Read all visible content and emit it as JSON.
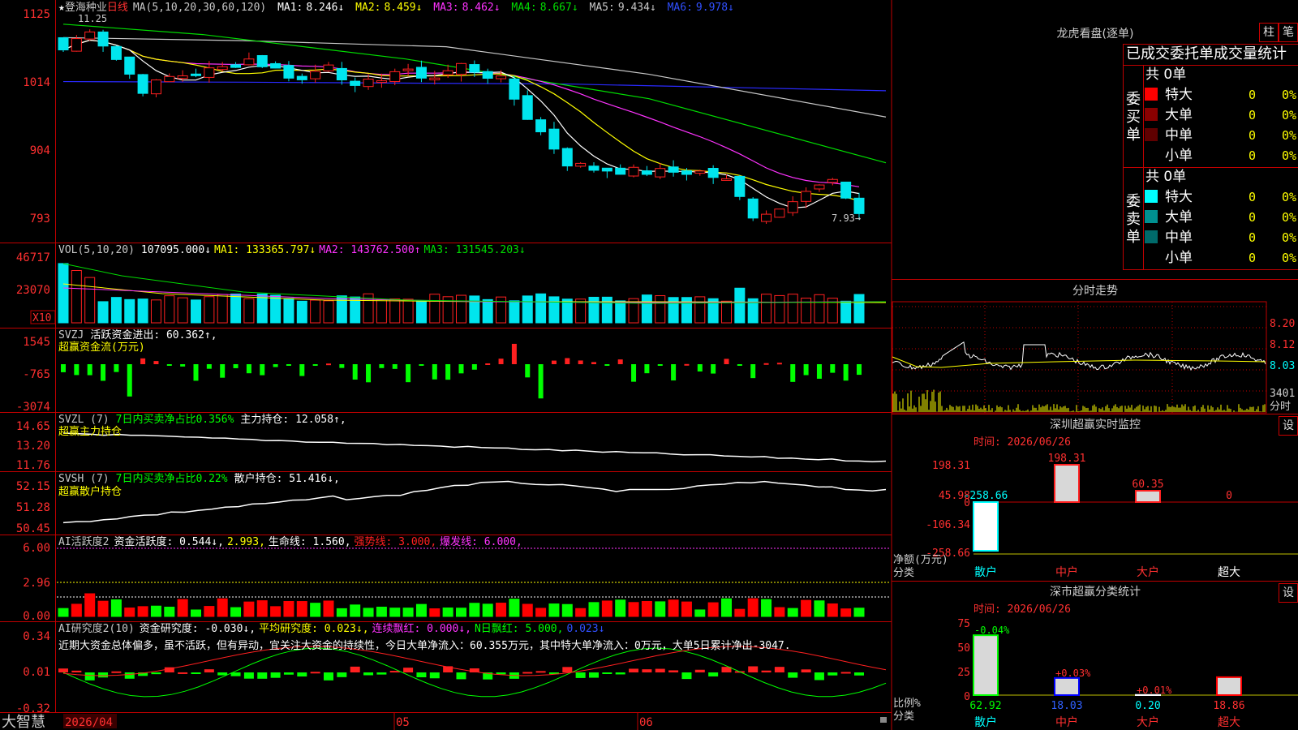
{
  "colors": {
    "up": "#ff2020",
    "down": "#00e5ee",
    "border": "#c00000",
    "axis_text": "#ff3030",
    "ma1": "#ffffff",
    "ma2": "#ffff00",
    "ma3": "#ff33ff",
    "ma4": "#00dd00",
    "ma5": "#c8c8c8",
    "ma6": "#2a2aff"
  },
  "chart": {
    "stock_name": "登海种业",
    "period": "日线",
    "ma_params": "MA(5,10,20,30,60,120)",
    "ma": [
      {
        "label": "MA1:",
        "value": "8.246↓"
      },
      {
        "label": "MA2:",
        "value": "8.459↓"
      },
      {
        "label": "MA3:",
        "value": "8.462↓"
      },
      {
        "label": "MA4:",
        "value": "8.667↓"
      },
      {
        "label": "MA5:",
        "value": "9.434↓"
      },
      {
        "label": "MA6:",
        "value": "9.978↓"
      }
    ],
    "high_note": "11.25",
    "low_note": "7.93→",
    "price_axis": [
      "1125",
      "1014",
      "904",
      "793"
    ],
    "vol": {
      "params": "VOL(5,10,20)",
      "value": "107095.000↓",
      "ma1": "MA1: 133365.797↓",
      "ma2": "MA2: 143762.500↑",
      "ma3": "MA3: 131545.203↓",
      "axis": [
        "46717",
        "23070"
      ],
      "unit": "X10"
    },
    "svzj": {
      "name": "SVZJ",
      "label": "活跃资金进出: 60.362↑,",
      "sub": "超赢资金流(万元)",
      "axis": [
        "1545",
        "-765",
        "-3074"
      ]
    },
    "svzl": {
      "name": "SVZL (7)",
      "label1": "7日内买卖净占比0.356%",
      "label2": "主力持仓: 12.058↑,",
      "sub": "超赢主力持仓",
      "axis": [
        "14.65",
        "13.20",
        "11.76"
      ]
    },
    "svsh": {
      "name": "SVSH (7)",
      "label1": "7日内买卖净占比0.22%",
      "label2": "散户持仓: 51.416↓,",
      "sub": "超赢散户持仓",
      "axis": [
        "52.15",
        "51.28",
        "50.45"
      ]
    },
    "ai1": {
      "name": "AI活跃度2",
      "label": "资金活跃度: 0.544↓,",
      "v2": "2.993,",
      "v3": "生命线: 1.560,",
      "v4": "强势线: 3.000,",
      "v5": "爆发线: 6.000,",
      "axis": [
        "6.00",
        "2.96",
        "0.00"
      ]
    },
    "ai2": {
      "name": "AI研究度2(10)",
      "label": "资金研究度: -0.030↓,",
      "v2": "平均研究度: 0.023↓,",
      "v3": "连续飘红: 0.000↓,",
      "v4": "N日飘红: 5.000,",
      "v5": "0.023↓",
      "comment": "近期大资金总体偏多，虽不活跃，但有异动，宜关注大资金的持续性，今日大单净流入：60.355万元，其中特大单净流入：0万元，大单5日累计净出-3047.",
      "axis": [
        "0.34",
        "0.01",
        "-0.32"
      ]
    },
    "dates": [
      "2026/04",
      "05",
      "06"
    ],
    "brand": "大智慧"
  },
  "right": {
    "lhkp_title": "龙虎看盘(逐单)",
    "btn_zhu": "柱",
    "btn_bi": "笔",
    "stat_header": "已成交委托单成交量统计",
    "buy": {
      "label": "委买单",
      "total": "共 0单",
      "rows": [
        {
          "name": "特大",
          "v": "0",
          "p": "0%",
          "c": "#ff0000"
        },
        {
          "name": "大单",
          "v": "0",
          "p": "0%",
          "c": "#8a0000"
        },
        {
          "name": "中单",
          "v": "0",
          "p": "0%",
          "c": "#600000"
        },
        {
          "name": "小单",
          "v": "0",
          "p": "0%",
          "c": "#000000"
        }
      ]
    },
    "sell": {
      "label": "委卖单",
      "total": "共 0单",
      "rows": [
        {
          "name": "特大",
          "v": "0",
          "p": "0%",
          "c": "#00ffff"
        },
        {
          "name": "大单",
          "v": "0",
          "p": "0%",
          "c": "#009090"
        },
        {
          "name": "中单",
          "v": "0",
          "p": "0%",
          "c": "#006a6a"
        },
        {
          "name": "小单",
          "v": "0",
          "p": "0%",
          "c": "#000000"
        }
      ]
    },
    "fenshi": {
      "title": "分时走势",
      "axis": [
        "8.20",
        "8.12",
        "8.03",
        "3401",
        "分时"
      ]
    },
    "monitor": {
      "title": "深圳超赢实时监控",
      "time": "时间: 2026/06/26",
      "btn": "设",
      "axis": [
        "198.31",
        "45.98",
        "0",
        "-106.34",
        "-258.66"
      ],
      "ylabel": "净额(万元)",
      "xlabel": "分类",
      "bars": [
        {
          "cat": "散户",
          "value": -258.66,
          "label": "-258.66"
        },
        {
          "cat": "中户",
          "value": 198.31,
          "label": "198.31"
        },
        {
          "cat": "大户",
          "value": 60.35,
          "label": "60.35"
        },
        {
          "cat": "超大",
          "value": 0,
          "label": "0"
        }
      ]
    },
    "classify": {
      "title": "深市超赢分类统计",
      "time": "时间: 2026/06/26",
      "btn": "设",
      "axis": [
        "75",
        "50",
        "25",
        "0"
      ],
      "ylabel": "比例%",
      "xlabel": "分类",
      "bars": [
        {
          "cat": "散户",
          "value": 62.92,
          "top": "-0.04%"
        },
        {
          "cat": "中户",
          "value": 18.03,
          "top": "+0.03%"
        },
        {
          "cat": "大户",
          "value": 0.2,
          "top": "+0.01%"
        },
        {
          "cat": "超大",
          "value": 18.86,
          "top": ""
        }
      ],
      "values": [
        "62.92",
        "18.03",
        "0.20",
        "18.86"
      ]
    }
  }
}
